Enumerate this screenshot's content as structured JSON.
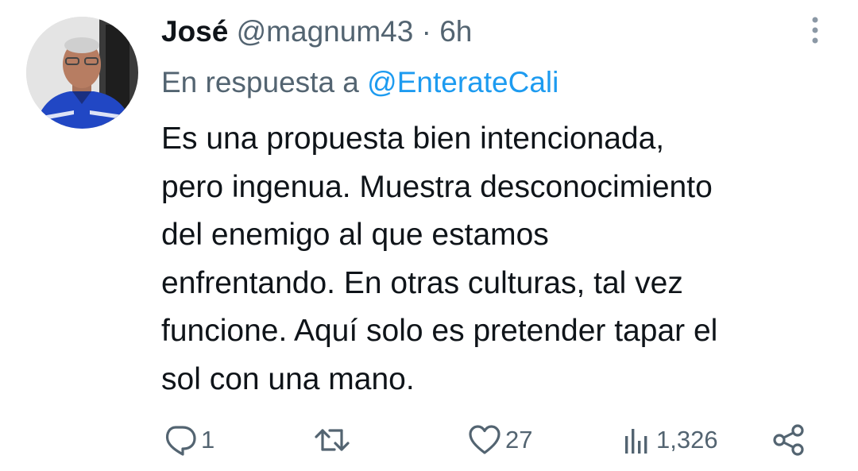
{
  "tweet": {
    "author_name": "José",
    "author_handle": "@magnum43",
    "separator": "·",
    "time": "6h",
    "reply_prefix": "En respuesta a",
    "reply_mention": "@EnterateCali",
    "body_lines": [
      "Es una propuesta bien intencionada,",
      "pero ingenua. Muestra desconocimiento",
      "del enemigo al que estamos",
      "enfrentando. En otras culturas, tal vez",
      "funcione. Aquí solo es pretender tapar el",
      "sol con una mano."
    ]
  },
  "actions": {
    "reply_count": "1",
    "retweet_count": "",
    "like_count": "27",
    "views_count": "1,326"
  },
  "icons": {
    "more": "more-vertical-icon",
    "reply": "reply-icon",
    "retweet": "retweet-icon",
    "like": "heart-icon",
    "views": "views-icon",
    "share": "share-icon"
  },
  "colors": {
    "text": "#0f1419",
    "secondary": "#536471",
    "accent": "#1d9bf0",
    "background": "#ffffff"
  }
}
